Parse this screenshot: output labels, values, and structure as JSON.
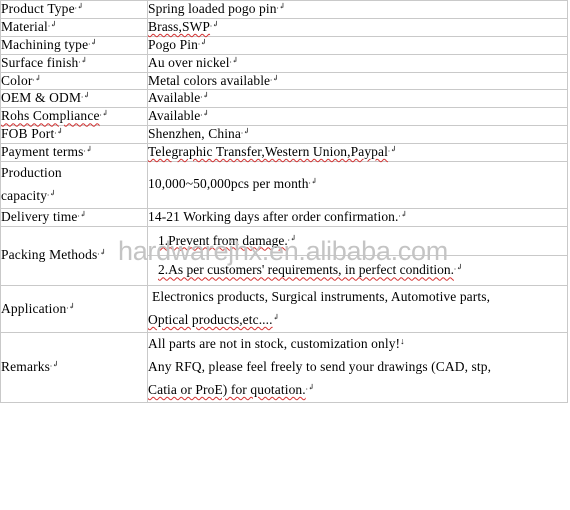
{
  "watermark": {
    "text": "hardwarejhx.en.alibaba.com",
    "color": "#c4c4c4"
  },
  "table": {
    "border_color": "#c9c9c9",
    "rows": [
      {
        "label": "Product Type",
        "value": "Spring loaded pogo pin"
      },
      {
        "label": "Material",
        "value": "Brass,SWP"
      },
      {
        "label": "Machining type",
        "value": "Pogo Pin"
      },
      {
        "label": "Surface finish",
        "value": "Au over nickel"
      },
      {
        "label": "Color",
        "value": "Metal colors available"
      },
      {
        "label": "OEM & ODM",
        "value": "Available"
      },
      {
        "label": "Rohs Compliance",
        "value": "Available"
      },
      {
        "label": "FOB Port",
        "value": "Shenzhen, China"
      },
      {
        "label": "Payment terms",
        "value": "Telegraphic Transfer,Western Union,Paypal"
      },
      {
        "label_line1": "Production",
        "label_line2": "capacity",
        "value": "10,000~50,000pcs per month"
      },
      {
        "label": "Delivery time",
        "value": "14-21 Working days after order confirmation."
      },
      {
        "label": "Packing Methods",
        "value_line1": "1.Prevent from damage.",
        "value_line2": "2.As per customers' requirements, in perfect condition."
      },
      {
        "label": "Application",
        "value_line1": "Electronics products, Surgical instruments, Automotive parts,",
        "value_line2": "Optical products,etc...."
      },
      {
        "label": "Remarks",
        "value_line1": "All parts are not in stock, customization only!",
        "value_line2": "Any RFQ, please feel freely to send your drawings (CAD, stp,",
        "value_line3": "Catia or ProE) for quotation."
      }
    ]
  }
}
